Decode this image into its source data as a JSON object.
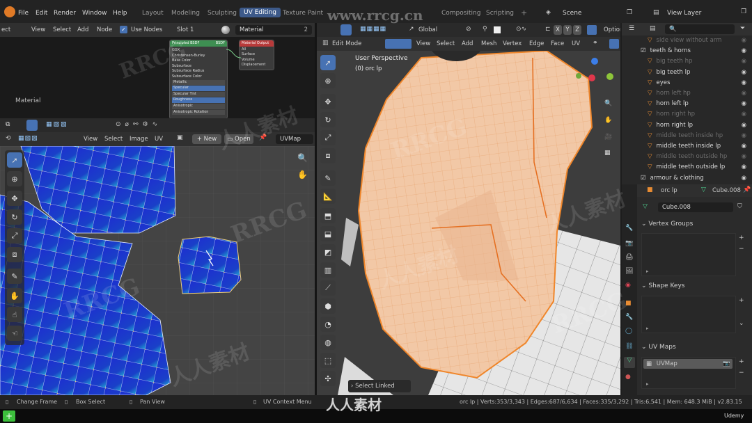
{
  "topbar": {
    "menus": [
      "File",
      "Edit",
      "Render",
      "Window",
      "Help"
    ],
    "workspaces": [
      "Layout",
      "Modeling",
      "Sculpting",
      "UV Editing",
      "Texture Paint",
      "Compositing",
      "Scripting"
    ],
    "active_workspace": "UV Editing",
    "add_tab": "+",
    "scene_label": "Scene",
    "view_layer_label": "View Layer"
  },
  "node_editor": {
    "header": {
      "select_label": "ect",
      "view": "View",
      "select": "Select",
      "add": "Add",
      "node": "Node",
      "use_nodes": "Use Nodes",
      "slot": "Slot 1",
      "material": "Material",
      "users": "2"
    },
    "frame_label": "Material",
    "bsdf_title": "Principled BSDF",
    "bsdf_badge": "BSDF",
    "bsdf_fields": [
      "GGX",
      "Christensen-Burley",
      "Base Color",
      "Subsurface",
      "Subsurface Radius",
      "Subsurface Color",
      "Metallic",
      "Specular",
      "Specular Tint",
      "Roughness",
      "Anisotropic",
      "Anisotropic Rotation"
    ],
    "output_title": "Material Output",
    "output_fields": [
      "All",
      "Surface",
      "Volume",
      "Displacement"
    ]
  },
  "uv_editor": {
    "header": {
      "view": "View",
      "select": "Select",
      "image": "Image",
      "uv": "UV",
      "new": "New",
      "open": "Open",
      "uvmap": "UVMap"
    }
  },
  "viewport": {
    "header": {
      "mode": "Edit Mode",
      "view": "View",
      "select": "Select",
      "add": "Add",
      "mesh": "Mesh",
      "vertex": "Vertex",
      "edge": "Edge",
      "face": "Face",
      "uv": "UV",
      "orientation": "Global",
      "axes": [
        "X",
        "Y",
        "Z"
      ],
      "options": "Option"
    },
    "perspective": "User Perspective",
    "object_label": "(0) orc lp",
    "last_op": "Select Linked"
  },
  "outliner": {
    "items": [
      {
        "label": "side view without arm",
        "dim": true,
        "indent": 1
      },
      {
        "label": "teeth & horns",
        "dim": false,
        "indent": 0
      },
      {
        "label": "big teeth hp",
        "dim": true,
        "indent": 1
      },
      {
        "label": "big teeth lp",
        "dim": false,
        "indent": 1
      },
      {
        "label": "eyes",
        "dim": false,
        "indent": 1
      },
      {
        "label": "horn left hp",
        "dim": true,
        "indent": 1
      },
      {
        "label": "horn left lp",
        "dim": false,
        "indent": 1
      },
      {
        "label": "horn right hp",
        "dim": true,
        "indent": 1
      },
      {
        "label": "horn right lp",
        "dim": false,
        "indent": 1
      },
      {
        "label": "middle teeth inside hp",
        "dim": true,
        "indent": 1
      },
      {
        "label": "middle teeth inside lp",
        "dim": false,
        "indent": 1
      },
      {
        "label": "middle teeth outside hp",
        "dim": true,
        "indent": 1
      },
      {
        "label": "middle teeth outside lp",
        "dim": false,
        "indent": 1
      },
      {
        "label": "armour & clothing",
        "dim": false,
        "indent": 0
      }
    ]
  },
  "properties": {
    "object_name": "orc lp",
    "mesh_name": "Cube.008",
    "data_field": "Cube.008",
    "vertex_groups": "Vertex Groups",
    "shape_keys": "Shape Keys",
    "uv_maps": "UV Maps",
    "uv_map_item": "UVMap"
  },
  "statusbar": {
    "change_frame": "Change Frame",
    "box_select": "Box Select",
    "pan_view": "Pan View",
    "uv_context": "UV Context Menu",
    "stats": "orc lp | Verts:353/3,343 | Edges:687/6,634 | Faces:335/3,292 | Tris:6,541 | Mem: 648.3 MiB | v2.83.15",
    "udemy": "Udemy"
  },
  "watermarks": {
    "site": "www.rrcg.cn",
    "brand": "RRCG",
    "cn": "人人素材"
  },
  "colors": {
    "accent": "#4772b3",
    "selected_orange": "#f0862a",
    "uv_blue": "#1d3ad0",
    "mesh_skin": "#f2c8a6"
  }
}
